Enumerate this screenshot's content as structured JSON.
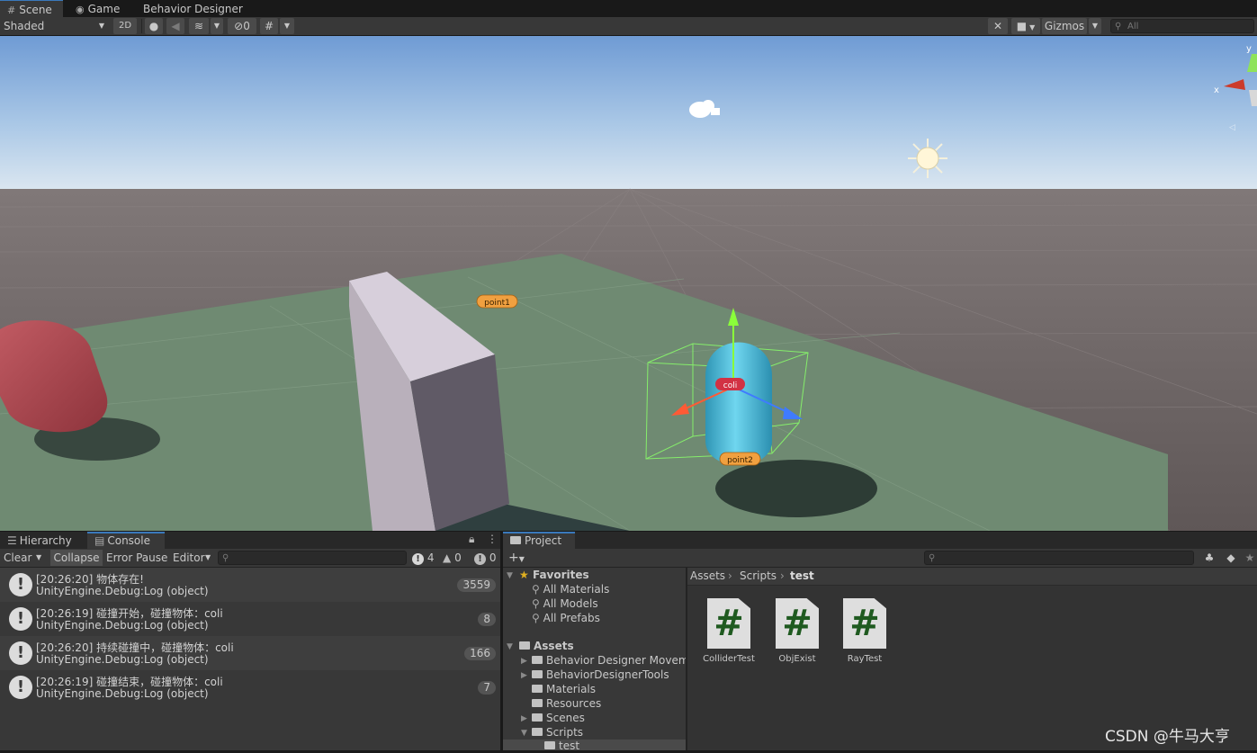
{
  "scene_tabs": [
    {
      "label": "Scene",
      "icon": "grid-icon"
    },
    {
      "label": "Game",
      "icon": "gamepad-icon"
    },
    {
      "label": "Behavior Designer"
    }
  ],
  "scene_toolbar": {
    "shading_mode": "Shaded",
    "mode_2d": "2D",
    "hidden_count": "0",
    "gizmos_label": "Gizmos",
    "search_placeholder": "All"
  },
  "scene": {
    "labels": {
      "point1": "point1",
      "point2": "point2",
      "coli": "coli"
    },
    "gizmo_axes": {
      "y": "y",
      "x": "x"
    },
    "colors": {
      "sky_top": "#6f9bd4",
      "ground": "#6b6060",
      "plane": "#6f8a72",
      "selection": "#8aff6a",
      "capsule": "#55c4e0"
    }
  },
  "console": {
    "tabs": [
      {
        "label": "Hierarchy",
        "icon": "hierarchy-icon"
      },
      {
        "label": "Console",
        "icon": "console-icon"
      }
    ],
    "toolbar": {
      "clear": "Clear",
      "collapse": "Collapse",
      "error_pause": "Error Pause",
      "editor": "Editor",
      "log_count": "4",
      "warning_count": "0",
      "error_count": "0"
    },
    "logs": [
      {
        "message": "[20:26:20] 物体存在!",
        "source": "UnityEngine.Debug:Log (object)",
        "count": "3559"
      },
      {
        "message": "[20:26:19] 碰撞开始，碰撞物体：coli",
        "source": "UnityEngine.Debug:Log (object)",
        "count": "8"
      },
      {
        "message": "[20:26:20] 持续碰撞中，碰撞物体：coli",
        "source": "UnityEngine.Debug:Log (object)",
        "count": "166"
      },
      {
        "message": "[20:26:19] 碰撞结束，碰撞物体：coli",
        "source": "UnityEngine.Debug:Log (object)",
        "count": "7"
      }
    ]
  },
  "project": {
    "tab": "Project",
    "favorites_title": "Favorites",
    "favorites": [
      "All Materials",
      "All Models",
      "All Prefabs"
    ],
    "assets_title": "Assets",
    "folders": [
      "Behavior Designer Moveme",
      "BehaviorDesignerTools",
      "Materials",
      "Resources",
      "Scenes",
      "Scripts",
      "test"
    ],
    "breadcrumb": [
      "Assets",
      "Scripts",
      "test"
    ],
    "files": [
      {
        "name": "ColliderTest",
        "glyph": "#"
      },
      {
        "name": "ObjExist",
        "glyph": "#"
      },
      {
        "name": "RayTest",
        "glyph": "#"
      }
    ]
  },
  "watermark": "CSDN @牛马大亨"
}
